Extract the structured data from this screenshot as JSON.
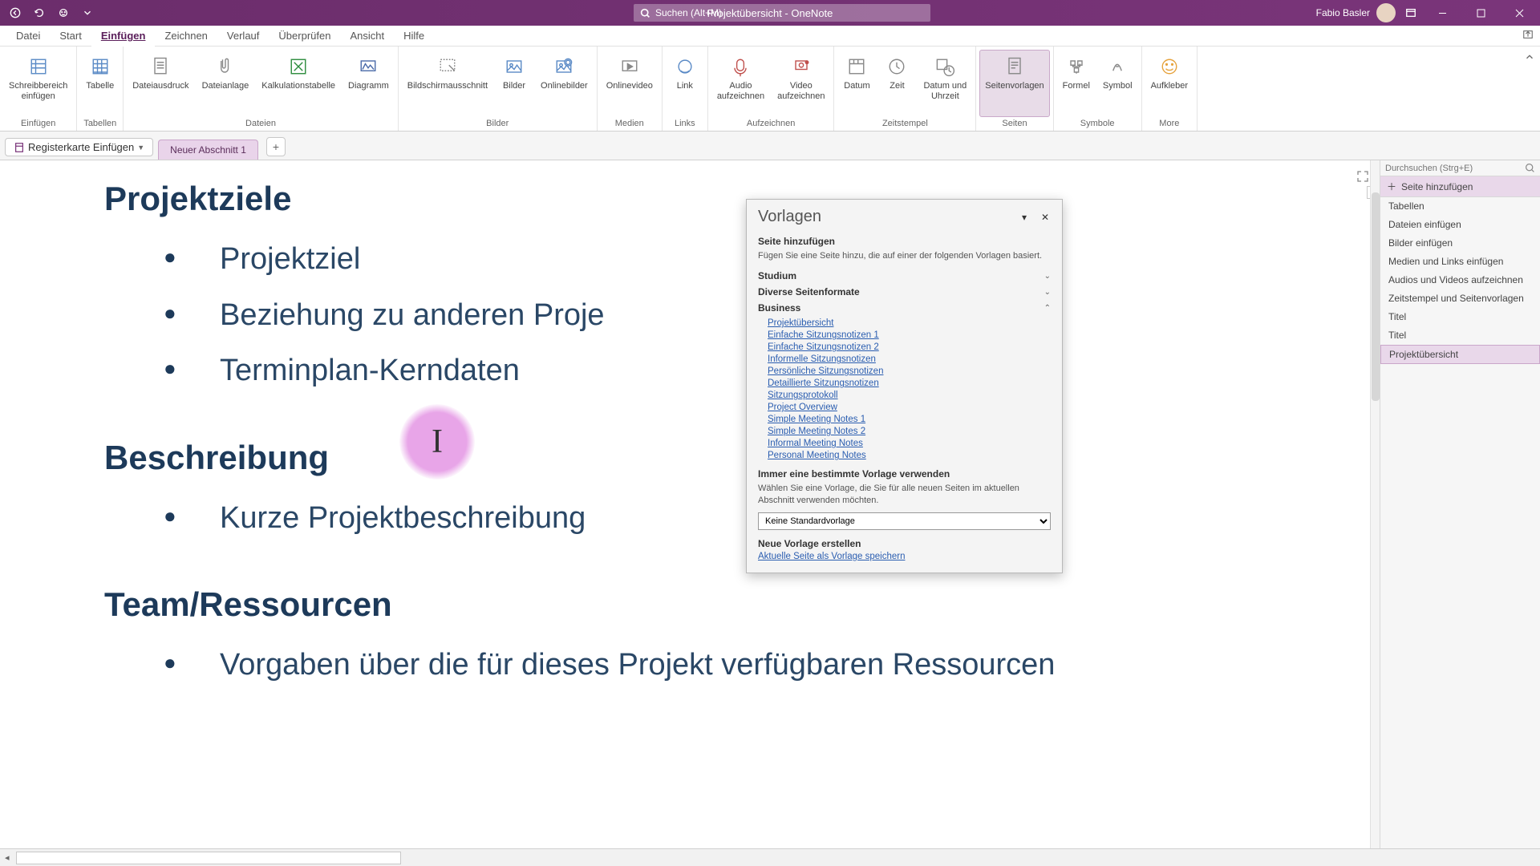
{
  "titlebar": {
    "doc_title": "Projektübersicht  -  OneNote",
    "search_placeholder": "Suchen (Alt+M)",
    "user_name": "Fabio Basler"
  },
  "menu": {
    "items": [
      "Datei",
      "Start",
      "Einfügen",
      "Zeichnen",
      "Verlauf",
      "Überprüfen",
      "Ansicht",
      "Hilfe"
    ],
    "active_index": 2
  },
  "ribbon": {
    "groups": [
      {
        "label": "Einfügen",
        "buttons": [
          {
            "text": "Schreibbereich\neinfügen"
          }
        ]
      },
      {
        "label": "Tabellen",
        "buttons": [
          {
            "text": "Tabelle"
          }
        ]
      },
      {
        "label": "Dateien",
        "buttons": [
          {
            "text": "Dateiausdruck"
          },
          {
            "text": "Dateianlage"
          },
          {
            "text": "Kalkulationstabelle"
          },
          {
            "text": "Diagramm"
          }
        ]
      },
      {
        "label": "Bilder",
        "buttons": [
          {
            "text": "Bildschirmausschnitt"
          },
          {
            "text": "Bilder"
          },
          {
            "text": "Onlinebilder"
          }
        ]
      },
      {
        "label": "Medien",
        "buttons": [
          {
            "text": "Onlinevideo"
          }
        ]
      },
      {
        "label": "Links",
        "buttons": [
          {
            "text": "Link"
          }
        ]
      },
      {
        "label": "Aufzeichnen",
        "buttons": [
          {
            "text": "Audio\naufzeichnen"
          },
          {
            "text": "Video\naufzeichnen"
          }
        ]
      },
      {
        "label": "Zeitstempel",
        "buttons": [
          {
            "text": "Datum"
          },
          {
            "text": "Zeit"
          },
          {
            "text": "Datum und\nUhrzeit"
          }
        ]
      },
      {
        "label": "Seiten",
        "buttons": [
          {
            "text": "Seitenvorlagen",
            "selected": true
          }
        ]
      },
      {
        "label": "Symbole",
        "buttons": [
          {
            "text": "Formel"
          },
          {
            "text": "Symbol"
          }
        ]
      },
      {
        "label": "More",
        "buttons": [
          {
            "text": "Aufkleber"
          }
        ]
      }
    ]
  },
  "subtabs": {
    "nav_label": "Registerkarte Einfügen",
    "section_tab": "Neuer Abschnitt 1"
  },
  "page_content": {
    "h1": "Projektziele",
    "b1": [
      "Projektziel",
      "Beziehung zu anderen Proje",
      "Terminplan-Kerndaten"
    ],
    "h2": "Beschreibung",
    "b2": [
      "Kurze Projektbeschreibung"
    ],
    "h3": "Team/Ressourcen",
    "b3": [
      "Vorgaben über die für dieses Projekt verfügbaren Ressourcen"
    ]
  },
  "templates": {
    "title": "Vorlagen",
    "add_page_title": "Seite hinzufügen",
    "add_page_desc": "Fügen Sie eine Seite hinzu, die auf einer der folgenden Vorlagen basiert.",
    "cat_studium": "Studium",
    "cat_diverse": "Diverse Seitenformate",
    "cat_business": "Business",
    "business_links": [
      "Projektübersicht",
      "Einfache Sitzungsnotizen 1",
      "Einfache Sitzungsnotizen 2",
      "Informelle Sitzungsnotizen",
      "Persönliche Sitzungsnotizen",
      "Detaillierte Sitzungsnotizen",
      "Sitzungsprotokoll",
      "Project Overview",
      "Simple Meeting Notes 1",
      "Simple Meeting Notes 2",
      "Informal Meeting Notes",
      "Personal Meeting Notes"
    ],
    "always_title": "Immer eine bestimmte Vorlage verwenden",
    "always_desc": "Wählen Sie eine Vorlage, die Sie für alle neuen Seiten im aktuellen Abschnitt verwenden möchten.",
    "select_value": "Keine Standardvorlage",
    "new_title": "Neue Vorlage erstellen",
    "new_link": "Aktuelle Seite als Vorlage speichern"
  },
  "sidepanel": {
    "search_placeholder": "Durchsuchen (Strg+E)",
    "add_page": "Seite hinzufügen",
    "items": [
      "Tabellen",
      "Dateien einfügen",
      "Bilder einfügen",
      "Medien und Links einfügen",
      "Audios und Videos aufzeichnen",
      "Zeitstempel und Seitenvorlagen",
      "Titel",
      "Titel",
      "Projektübersicht"
    ],
    "selected_index": 8
  }
}
